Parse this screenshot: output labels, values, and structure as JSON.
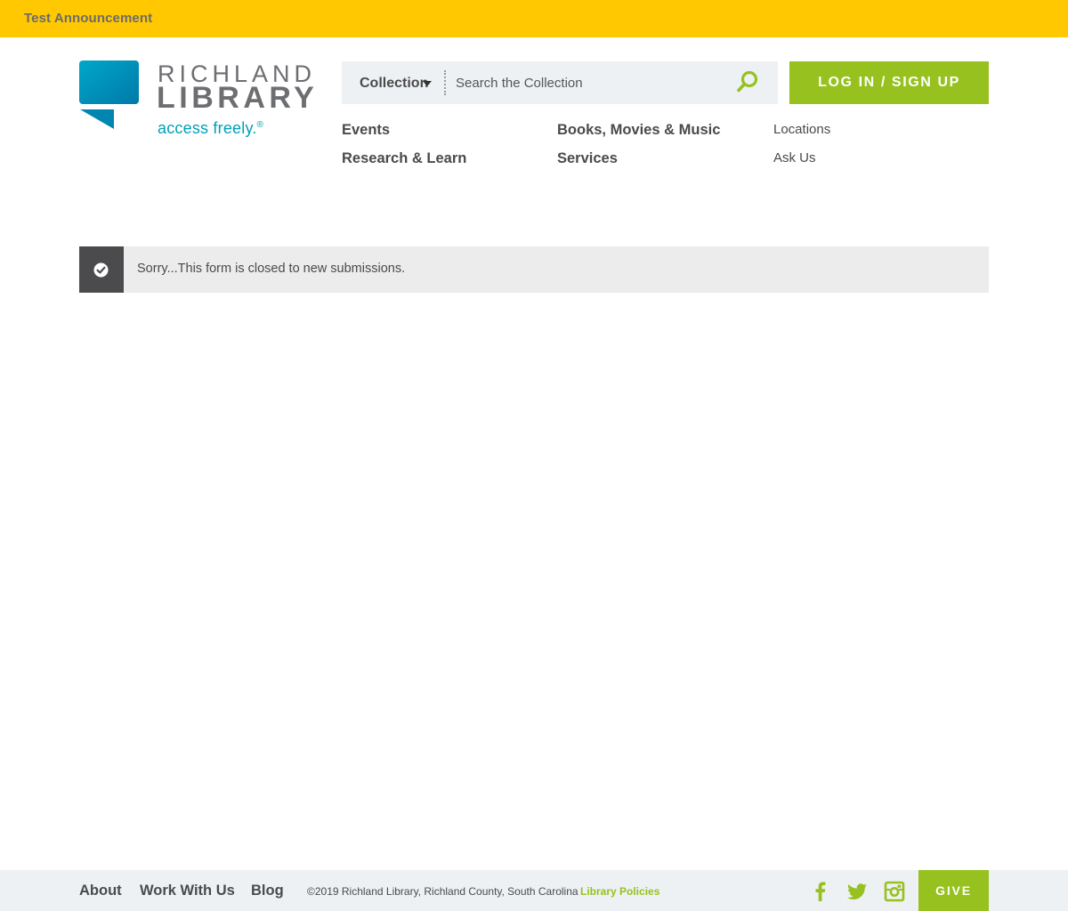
{
  "announcement": {
    "text": "Test Announcement"
  },
  "logo": {
    "line1": "RICHLAND",
    "line2": "LIBRARY",
    "tagline": "access freely.",
    "registered": "®"
  },
  "search": {
    "type_selected": "Collection",
    "placeholder": "Search the Collection",
    "button_icon": "search-icon"
  },
  "login": {
    "label": "LOG IN / SIGN UP"
  },
  "nav": {
    "primary": [
      "Events",
      "Research & Learn",
      "Books, Movies & Music",
      "Services"
    ],
    "secondary": [
      "Locations",
      "Ask Us"
    ]
  },
  "alert": {
    "icon": "check-circle-icon",
    "message": "Sorry...This form is closed to new submissions."
  },
  "footer": {
    "links": [
      "About",
      "Work With Us",
      "Blog"
    ],
    "copyright": "©2019 Richland Library, Richland County, South Carolina",
    "policies": "Library Policies",
    "social": [
      "facebook-icon",
      "twitter-icon",
      "instagram-icon"
    ],
    "give": "GIVE"
  },
  "colors": {
    "announcement_bg": "#ffc800",
    "accent_green": "#96c11f",
    "brand_teal": "#00a0b5",
    "text_gray": "#4a4a4a",
    "search_bg": "#eef1f4",
    "alert_icon_bg": "#4b4b4d"
  }
}
